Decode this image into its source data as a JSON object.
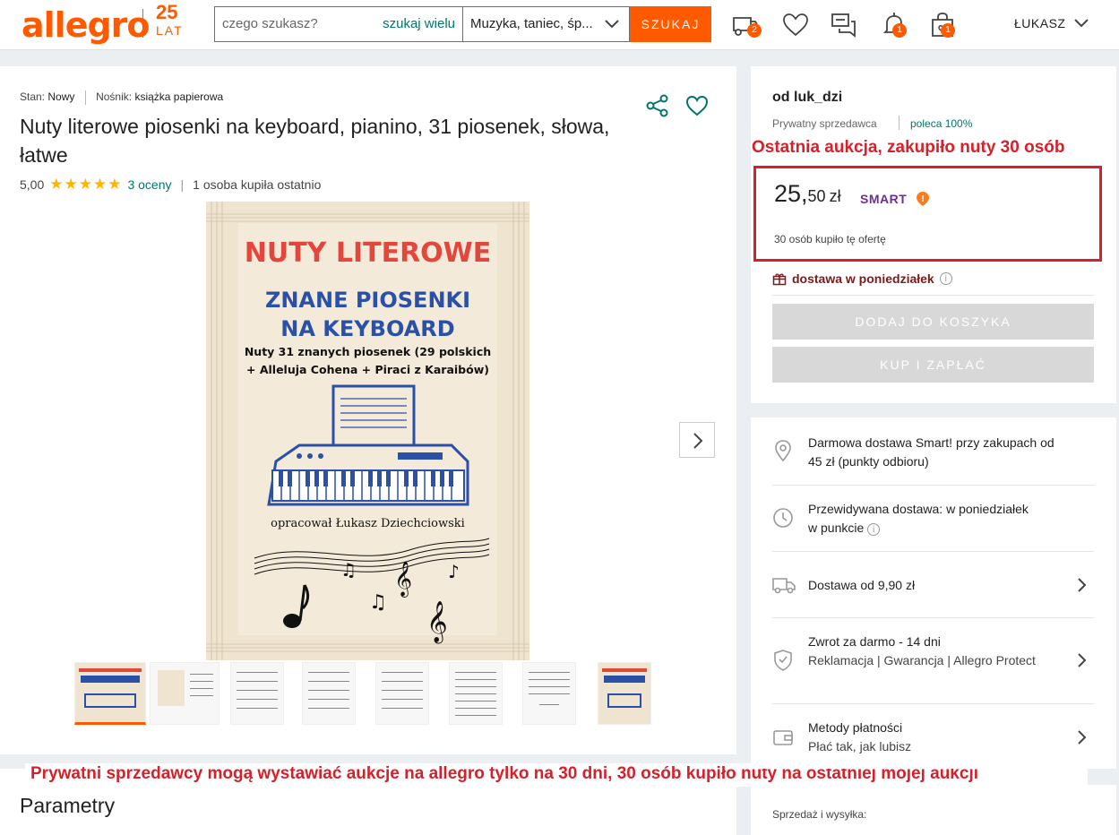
{
  "header": {
    "logo": "allegro",
    "anniversary_number": "25",
    "anniversary_word": "LAT",
    "search_placeholder": "czego szukasz?",
    "search_many_label": "szukaj wielu",
    "category_value": "Muzyka, taniec, śp...",
    "search_button": "SZUKAJ",
    "cart_badge": "2",
    "notifications_badge": "1",
    "orders_badge": "1",
    "user_name": "ŁUKASZ"
  },
  "product": {
    "condition_label": "Stan:",
    "condition_value": "Nowy",
    "medium_label": "Nośnik:",
    "medium_value": "książka papierowa",
    "title": "Nuty literowe piosenki na keyboard, pianino, 31 piosenek, słowa, łatwe",
    "rating_value": "5,00",
    "stars": "★★★★★",
    "rating_count": "3 oceny",
    "recent_buyers": "1 osoba kupiła ostatnio",
    "cover": {
      "title": "NUTY LITEROWE",
      "subtitle_line1": "ZNANE PIOSENKI",
      "subtitle_line2": "NA KEYBOARD",
      "desc_line1": "Nuty 31 znanych piosenek (29 polskich",
      "desc_line2": "+ Alleluja Cohena + Piraci z Karaibów)",
      "author": "opracował Łukasz Dziechciowski"
    },
    "thumbnail_count": 8
  },
  "annotations": {
    "last_auction": "Ostatnia aukcja, zakupiło nuty 30 osób",
    "bottom_note": "Prywatni sprzedawcy mogą wystawiać aukcje na allegro tylko na 30 dni, 30 osób kupiło nuty na ostatniej mojej aukcji"
  },
  "params": {
    "title": "Parametry"
  },
  "buybox": {
    "seller_name": "od luk_dzi",
    "seller_type": "Prywatny sprzedawca",
    "recommends": "poleca 100%",
    "price_whole": "25,",
    "price_cents": "50",
    "currency": "zł",
    "smart_label": "SMART",
    "bought_text": "30 osób kupiło tę ofertę",
    "delivery_day": "dostawa w poniedziałek",
    "add_to_cart": "DODAJ DO KOSZYKA",
    "buy_now": "KUP I ZAPŁAĆ"
  },
  "info": {
    "free_delivery": "Darmowa dostawa Smart! przy zakupach od 45 zł (punkty odbioru)",
    "expected_line1": "Przewidywana dostawa: w poniedziałek",
    "expected_line2": "w punkcie",
    "delivery_from": "Dostawa od 9,90 zł",
    "returns_title": "Zwrot za darmo - 14 dni",
    "returns_sub": "Reklamacja | Gwarancja | Allegro Protect",
    "payments_title": "Metody płatności",
    "payments_sub": "Płać tak, jak lubisz"
  },
  "sales": {
    "label": "Sprzedaż i wysyłka:"
  },
  "colors": {
    "brand": "#ff5a00",
    "link": "#00766b",
    "annotation_red": "#d6202a",
    "smart_purple": "#6d2f90"
  }
}
